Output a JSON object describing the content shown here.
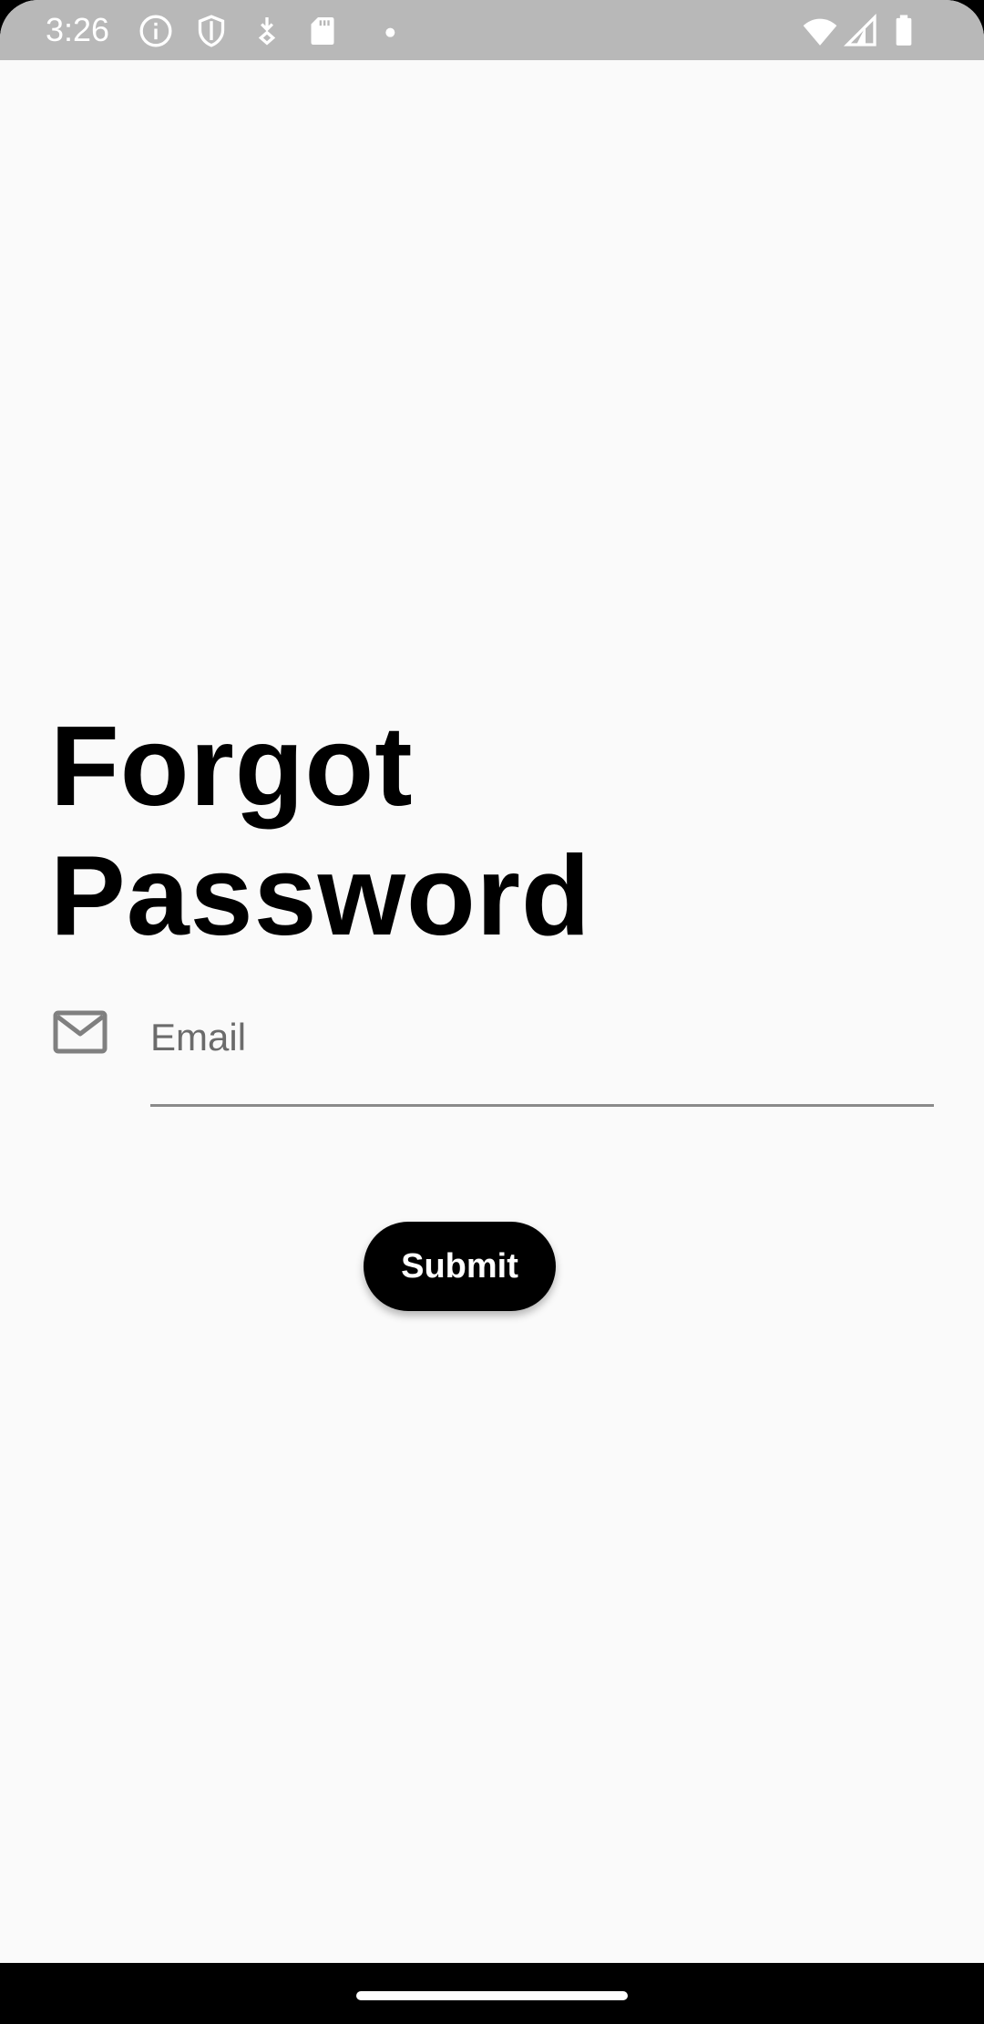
{
  "status_bar": {
    "time": "3:26",
    "icons": [
      "info-icon",
      "shield-icon",
      "download-icon",
      "sd-card-icon",
      "dot-icon",
      "wifi-icon",
      "signal-icon",
      "battery-icon"
    ]
  },
  "title": {
    "line1": "Forgot",
    "line2": "Password"
  },
  "email": {
    "icon": "mail-icon",
    "placeholder": "Email",
    "value": ""
  },
  "submit": {
    "label": "Submit"
  },
  "colors": {
    "background": "#fafafa",
    "status_bar": "#b8b8b8",
    "button": "#000000",
    "button_text": "#ffffff",
    "underline": "#8a8a8a"
  }
}
